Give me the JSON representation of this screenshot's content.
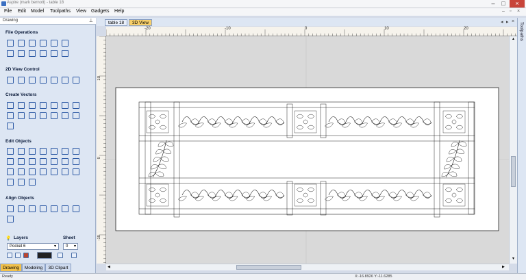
{
  "window": {
    "title": "Aspire (mark bernott) - table 18"
  },
  "menu": [
    "File",
    "Edit",
    "Model",
    "Toolpaths",
    "View",
    "Gadgets",
    "Help"
  ],
  "left_panel": {
    "header": "Drawing",
    "sections": {
      "file_ops": "File Operations",
      "view_ctrl": "2D View Control",
      "create_vectors": "Create Vectors",
      "edit_objects": "Edit Objects",
      "align_objects": "Align Objects"
    },
    "layers_label": "Layers",
    "layer_value": "Pocket 6",
    "sheet_label": "Sheet",
    "sheet_value": "0",
    "bottom_tabs": [
      "Drawing",
      "Modeling",
      "3D Clipart"
    ]
  },
  "doc_tabs": [
    "table 18",
    "3D View"
  ],
  "right_panel_label": "Toolpaths",
  "ruler": {
    "top_ticks": [
      "-20",
      "-10",
      "0",
      "10",
      "20"
    ],
    "left_ticks": [
      "10",
      "0",
      "-10"
    ]
  },
  "status": {
    "left": "Ready",
    "coords": "X:-16.8926 Y:-11.6285"
  },
  "icons": {
    "file": [
      "new-file",
      "open-file",
      "save-file",
      "save-as-file",
      "import-file",
      "import-vectors",
      "fit-job",
      "cut",
      "copy",
      "paste",
      "undo",
      "redo"
    ],
    "view": [
      "pan",
      "zoom-box",
      "zoom-fit",
      "zoom-selected",
      "view-2d",
      "view-3d",
      "toggle-layers"
    ],
    "vectors": [
      "draw-circle",
      "draw-ellipse",
      "draw-rectangle",
      "draw-curve",
      "draw-polyline",
      "draw-arc",
      "draw-polygon",
      "draw-star",
      "draw-text",
      "text-on-curve",
      "auto-layout-text",
      "dimension",
      "fillet",
      "inlay",
      "draw-line"
    ],
    "edit": [
      "select",
      "node-edit",
      "transform",
      "align-nodes",
      "measure",
      "trim",
      "group",
      "ungroup",
      "join",
      "offset",
      "weld",
      "subtract",
      "intersect",
      "mirror",
      "move",
      "copy-along",
      "array",
      "weld-close",
      "smooth",
      "extend",
      "cut-at",
      "break",
      "mirror-vector",
      "distort"
    ],
    "align": [
      "align-left",
      "align-center",
      "align-right",
      "align-top",
      "align-middle",
      "align-bottom",
      "spread-horizontal",
      "spread-vertical"
    ]
  },
  "colors": {
    "accent_tab": "#f3c24b",
    "panel_bg": "#dde6f3",
    "canvas_bg": "#d9d9d9"
  }
}
